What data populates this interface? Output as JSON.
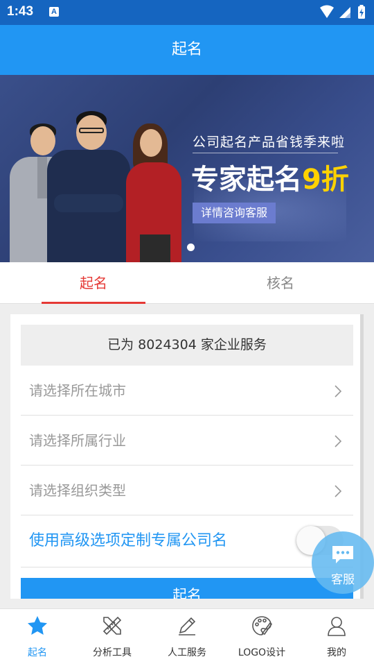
{
  "status_bar": {
    "time": "1:43",
    "notification_letter": "A"
  },
  "app_bar": {
    "title": "起名"
  },
  "banner": {
    "line1": "公司起名产品省钱季来啦",
    "line2_main": "专家起名",
    "line2_highlight": "9折",
    "button_label": "详情咨询客服",
    "highlight_color": "#ffd200"
  },
  "tabs": [
    {
      "label": "起名",
      "active": true
    },
    {
      "label": "核名",
      "active": false
    }
  ],
  "form": {
    "served_text": "已为 8024304 家企业服务",
    "rows": [
      {
        "label": "请选择所在城市"
      },
      {
        "label": "请选择所属行业"
      },
      {
        "label": "请选择组织类型"
      }
    ],
    "advanced_label": "使用高级选项定制专属公司名",
    "advanced_enabled": false,
    "submit_label": "起名"
  },
  "floating_service": {
    "label": "客服",
    "icon": "chat-icon"
  },
  "bottom_nav": [
    {
      "label": "起名",
      "icon": "star-icon",
      "active": true
    },
    {
      "label": "分析工具",
      "icon": "ruler-pencil-icon",
      "active": false
    },
    {
      "label": "人工服务",
      "icon": "pencil-icon",
      "active": false
    },
    {
      "label": "LOGO设计",
      "icon": "palette-icon",
      "active": false
    },
    {
      "label": "我的",
      "icon": "person-icon",
      "active": false
    }
  ],
  "colors": {
    "primary": "#2196f3",
    "status_bar": "#1565c0",
    "tab_active": "#e53935"
  }
}
